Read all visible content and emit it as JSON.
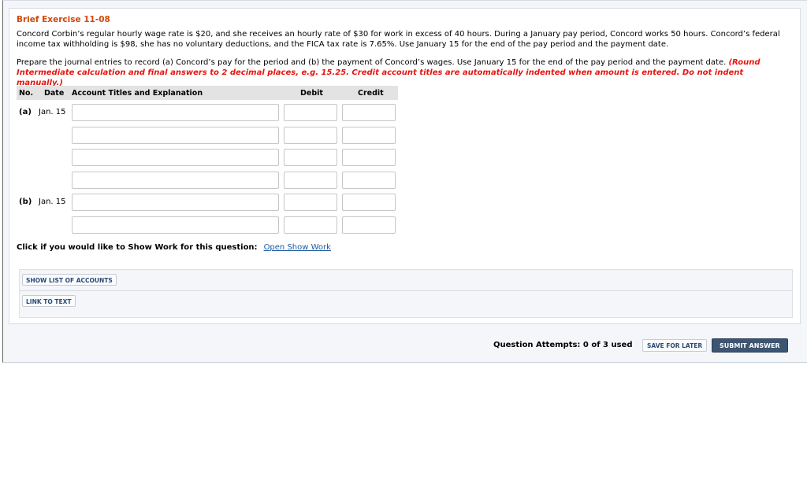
{
  "exercise": {
    "title": "Brief Exercise 11-08",
    "problem": "Concord Corbin’s regular hourly wage rate is $20, and she receives an hourly rate of $30 for work in excess of 40 hours. During a January pay period, Concord works 50 hours. Concord’s federal income tax withholding is $98, she has no voluntary deductions, and the FICA tax rate is 7.65%. Use January 15 for the end of the pay period and the payment date.",
    "instructions": "Prepare the journal entries to record (a) Concord’s pay for the period and (b) the payment of Concord’s wages. Use January 15 for the end of the pay period and the payment date. ",
    "note": "(Round Intermediate calculation and final answers to 2 decimal places, e.g. 15.25. Credit account titles are automatically indented when amount is entered. Do not indent manually.)"
  },
  "table": {
    "headers": {
      "no": "No.",
      "date": "Date",
      "account": "Account Titles and Explanation",
      "debit": "Debit",
      "credit": "Credit"
    },
    "entries": [
      {
        "no": "(a)",
        "date": "Jan. 15",
        "rows": 4
      },
      {
        "no": "(b)",
        "date": "Jan. 15",
        "rows": 2
      }
    ]
  },
  "show_work": {
    "prompt": "Click if you would like to Show Work for this question:",
    "link": "Open Show Work"
  },
  "buttons": {
    "show_list": "SHOW LIST OF ACCOUNTS",
    "link_text": "LINK TO TEXT",
    "save": "SAVE FOR LATER",
    "submit": "SUBMIT ANSWER"
  },
  "attempts": "Question Attempts: 0 of 3 used",
  "colors": {
    "title": "#d2480a",
    "note": "#e8140e",
    "submit": "#3d5573"
  }
}
